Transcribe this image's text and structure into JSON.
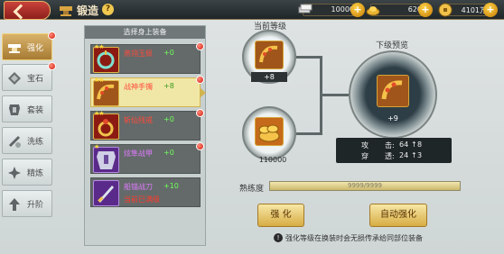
{
  "header": {
    "title": "锻造",
    "help_icon": "?"
  },
  "resources": [
    {
      "name": "silver-bars",
      "value": "10000",
      "plus": "+"
    },
    {
      "name": "gold-ingot",
      "value": "620",
      "plus": "+"
    },
    {
      "name": "copper-coin",
      "value": "4101万",
      "plus": "+"
    }
  ],
  "tabs": [
    {
      "label": "强化",
      "active": true,
      "dot": true,
      "icon": "anvil-icon"
    },
    {
      "label": "宝石",
      "active": false,
      "dot": true,
      "icon": "gem-icon"
    },
    {
      "label": "套装",
      "active": false,
      "dot": false,
      "icon": "armor-icon"
    },
    {
      "label": "洗练",
      "active": false,
      "dot": false,
      "icon": "refine-icon"
    },
    {
      "label": "精炼",
      "active": false,
      "dot": false,
      "icon": "spark-icon"
    },
    {
      "label": "升阶",
      "active": false,
      "dot": false,
      "icon": "upgrade-icon"
    }
  ],
  "equipment_panel": {
    "title": "选择身上装备",
    "items": [
      {
        "name": "燕翎玉佩",
        "level": "+0",
        "stars": "★★",
        "icon": "jade-pendant-icon",
        "selected": false,
        "dot": true
      },
      {
        "name": "战神手镯",
        "level": "+8",
        "stars": "★★",
        "icon": "bracelet-icon",
        "selected": true,
        "dot": true
      },
      {
        "name": "斩仙残戒",
        "level": "+0",
        "stars": "★★",
        "icon": "ring-icon",
        "selected": false,
        "dot": true
      },
      {
        "name": "炫隼战甲",
        "level": "+0",
        "stars": "★",
        "icon": "armor-icon",
        "selected": false,
        "dot": true
      },
      {
        "name": "船锚战刀",
        "level": "+10",
        "stars": "",
        "icon": "sword-icon",
        "selected": false,
        "dot": false,
        "sub": "当前已满级"
      }
    ]
  },
  "current_level": {
    "label": "当前等级",
    "value": "+8",
    "icon": "bracelet-icon"
  },
  "material": {
    "count": "110000",
    "icon": "coins-icon"
  },
  "preview": {
    "label": "下级预览",
    "value": "+9",
    "icon": "bracelet-icon",
    "stats": [
      {
        "name": "攻",
        "name2": "击:",
        "value": "64",
        "gain": "8"
      },
      {
        "name": "穿",
        "name2": "透:",
        "value": "24",
        "gain": "3"
      }
    ]
  },
  "proficiency": {
    "label": "熟练度",
    "text": "9999/9999",
    "fill": 1.0
  },
  "buttons": {
    "strengthen": "强 化",
    "auto_strengthen": "自动强化"
  },
  "notice": "强化等级在换装时会无损传承给同部位装备",
  "colors": {
    "accent_gold": "#d7ad45",
    "red_text": "#ff4a3a",
    "green_text": "#6fff5a"
  }
}
